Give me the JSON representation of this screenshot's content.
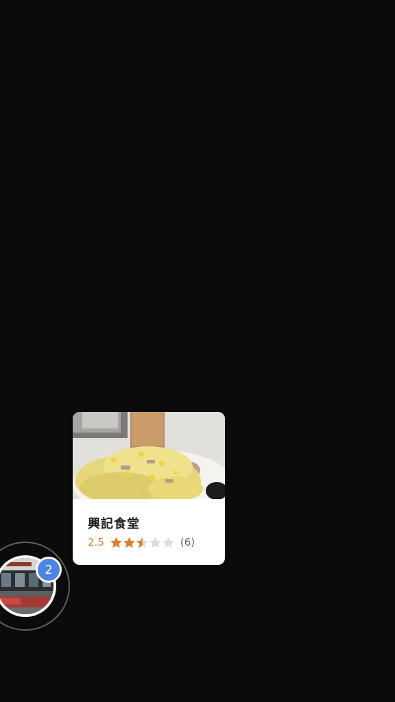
{
  "place_card": {
    "name": "興記食堂",
    "rating": "2.5",
    "rating_value": 2.5,
    "max_rating": 5,
    "review_count": "(6)",
    "photo_icon": "food-photo"
  },
  "cluster_marker": {
    "count": "2",
    "photo_icon": "storefront-photo"
  },
  "colors": {
    "background": "#0b0b0b",
    "rating_orange": "#e07e2c",
    "star_filled": "#e07e2c",
    "star_empty": "#dadce0",
    "badge_blue": "#4a84e6"
  }
}
